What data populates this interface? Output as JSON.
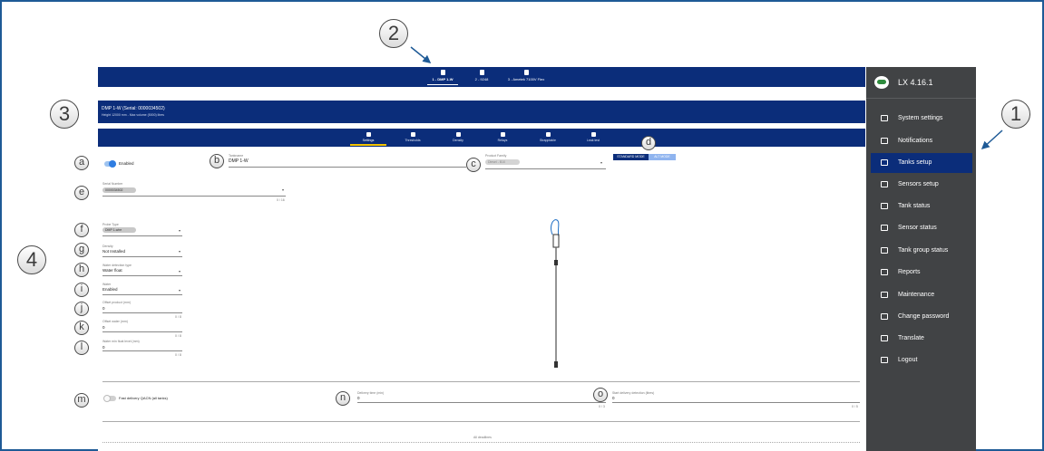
{
  "callouts": {
    "big": [
      "2",
      "3",
      "4",
      "1"
    ],
    "small": [
      "a",
      "b",
      "c",
      "d",
      "e",
      "f",
      "g",
      "h",
      "i",
      "j",
      "k",
      "l",
      "m",
      "n",
      "o"
    ]
  },
  "tanks": [
    {
      "label": "1 - DMP 1-W",
      "active": true
    },
    {
      "label": "2 - 9248",
      "active": false
    },
    {
      "label": "3 - Ametek 7100V Flex",
      "active": false
    }
  ],
  "tank_info": {
    "title": "DMP 1-W (Serial: 0000034502)",
    "subtitle": "Height 12000 mm - Max volume (5000) litres"
  },
  "tabs": [
    {
      "label": "Settings",
      "active": true
    },
    {
      "label": "Thresholds",
      "active": false
    },
    {
      "label": "Density",
      "active": false
    },
    {
      "label": "Relays",
      "active": false
    },
    {
      "label": "Strapptable",
      "active": false
    },
    {
      "label": "Leak test",
      "active": false
    }
  ],
  "sidebar": {
    "version": "LX 4.16.1",
    "items": [
      {
        "label": "System settings",
        "icon": "monitor-icon",
        "active": false
      },
      {
        "label": "Notifications",
        "icon": "notifications-icon",
        "active": false
      },
      {
        "label": "Tanks setup",
        "icon": "database-icon",
        "active": true
      },
      {
        "label": "Sensors setup",
        "icon": "database-icon",
        "active": false
      },
      {
        "label": "Tank status",
        "icon": "waves-icon",
        "active": false
      },
      {
        "label": "Sensor status",
        "icon": "sensor-icon",
        "active": false
      },
      {
        "label": "Tank group status",
        "icon": "group-icon",
        "active": false
      },
      {
        "label": "Reports",
        "icon": "chart-icon",
        "active": false
      },
      {
        "label": "Maintenance",
        "icon": "wrench-icon",
        "active": false
      },
      {
        "label": "Change password",
        "icon": "key-icon",
        "active": false
      },
      {
        "label": "Translate",
        "icon": "translate-icon",
        "active": false
      },
      {
        "label": "Logout",
        "icon": "logout-icon",
        "active": false
      }
    ]
  },
  "form": {
    "enabled_label": "Enabled",
    "name_caption": "Tankname",
    "name_value": "DMP 1-W",
    "product_caption": "Product Family",
    "product_value": "Diesel - B10",
    "mode_standard": "STANDARD MODE",
    "mode_alt": "ALT MODE",
    "serial_caption": "Serial Number",
    "serial_value": "0000034502",
    "serial_counter": "0 / 16",
    "probe_caption": "Probe Type",
    "probe_value": "DMP 1-wire",
    "density_caption": "Density",
    "density_value": "Not Installed",
    "water_type_caption": "Water detection type",
    "water_type_value": "Water float",
    "water_caption": "Water",
    "water_value": "Enabled",
    "offset_product_caption": "Offset product (mm)",
    "offset_product_value": "0",
    "offset_product_counter": "0 / 8",
    "offset_water_caption": "Offset water (mm)",
    "offset_water_value": "0",
    "offset_water_counter": "0 / 8",
    "water_min_caption": "Water min float level (mm)",
    "water_min_value": "0",
    "water_min_counter": "0 / 8",
    "fast_delivery_label": "Fast delivery QACN (all tanks)",
    "delivery_time_caption": "Delivery time (min)",
    "delivery_time_value": "0",
    "delivery_time_counter": "0 / 3",
    "start_delivery_caption": "Start delivery detection (litres)",
    "start_delivery_value": "0",
    "start_delivery_counter": "0 / 5",
    "bottom_caption": "All deadlines"
  }
}
